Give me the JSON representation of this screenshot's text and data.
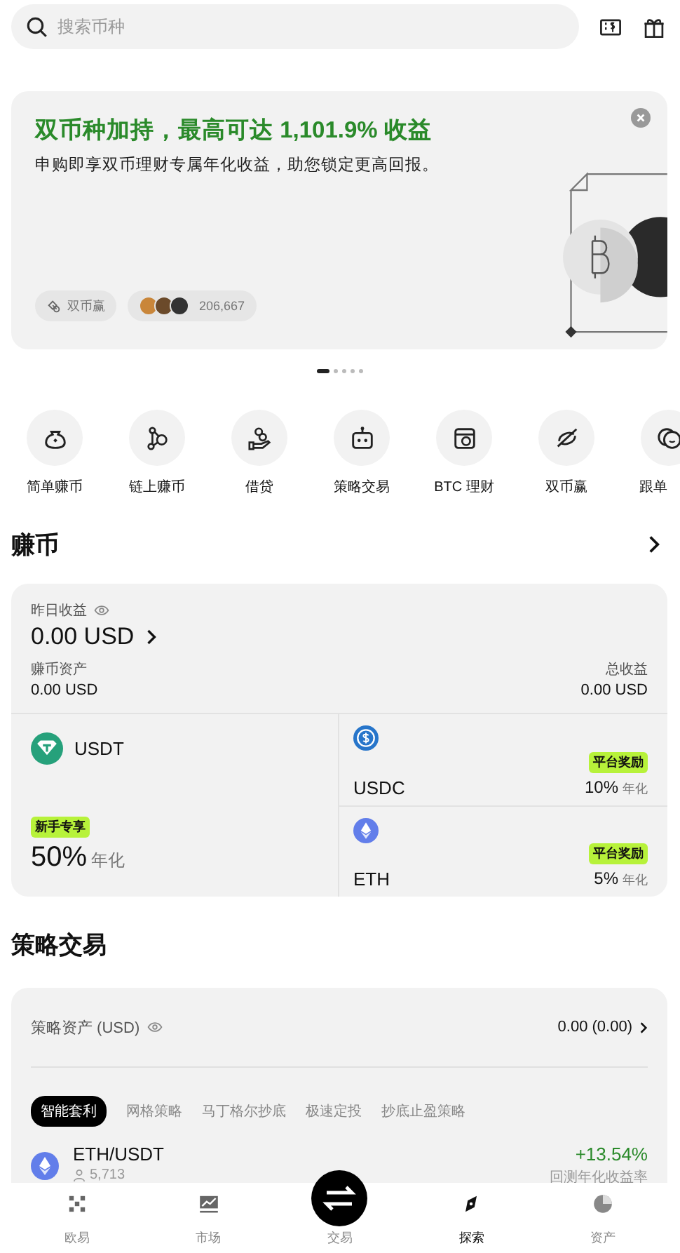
{
  "search": {
    "placeholder": "搜索币种"
  },
  "banner": {
    "title": "双币种加持，最高可达 1,101.9% 收益",
    "subtitle": "申购即享双币理财专属年化收益，助您锁定更高回报。",
    "tag": "双币赢",
    "participants": "206,667"
  },
  "pager": [
    {
      "selected": true
    },
    {
      "selected": false
    },
    {
      "selected": false
    },
    {
      "selected": false
    },
    {
      "selected": false
    }
  ],
  "shortcuts": [
    {
      "label": "简单赚币",
      "kind": "moneybag"
    },
    {
      "label": "链上赚币",
      "kind": "nodes"
    },
    {
      "label": "借贷",
      "kind": "loan"
    },
    {
      "label": "策略交易",
      "kind": "robot"
    },
    {
      "label": "BTC 理财",
      "kind": "vault"
    },
    {
      "label": "双币赢",
      "kind": "dual"
    },
    {
      "label": "跟单",
      "kind": "copy"
    }
  ],
  "earn": {
    "title": "赚币",
    "yesterday_label": "昨日收益",
    "yesterday_value": "0.00 USD",
    "assets_label": "赚币资产",
    "assets_value": "0.00 USD",
    "total_label": "总收益",
    "total_value": "0.00 USD",
    "products": [
      {
        "coin": "USDT",
        "kind": "usdt",
        "badge": "新手专享",
        "rate": "50%",
        "unit": "年化"
      },
      {
        "coin": "USDC",
        "kind": "usdc",
        "badge": "平台奖励",
        "rate": "10%",
        "unit": "年化"
      },
      {
        "coin": "ETH",
        "kind": "eth",
        "badge": "平台奖励",
        "rate": "5%",
        "unit": "年化"
      }
    ]
  },
  "strategy": {
    "title": "策略交易",
    "assets_label": "策略资产 (USD)",
    "assets_value": "0.00 (0.00)",
    "tabs": [
      {
        "label": "智能套利",
        "selected": true
      },
      {
        "label": "网格策略",
        "selected": false
      },
      {
        "label": "马丁格尔抄底",
        "selected": false
      },
      {
        "label": "极速定投",
        "selected": false
      },
      {
        "label": "抄底止盈策略",
        "selected": false
      }
    ],
    "rows": [
      {
        "pair": "ETH/USDT",
        "users": "5,713",
        "return": "+13.54%",
        "return_label": "回测年化收益率"
      }
    ]
  },
  "nav": [
    {
      "label": "欧易",
      "kind": "logo",
      "selected": false
    },
    {
      "label": "市场",
      "kind": "chart",
      "selected": false
    },
    {
      "label": "交易",
      "kind": "trade",
      "selected": false
    },
    {
      "label": "探索",
      "kind": "explore",
      "selected": true
    },
    {
      "label": "资产",
      "kind": "pie",
      "selected": false
    }
  ]
}
